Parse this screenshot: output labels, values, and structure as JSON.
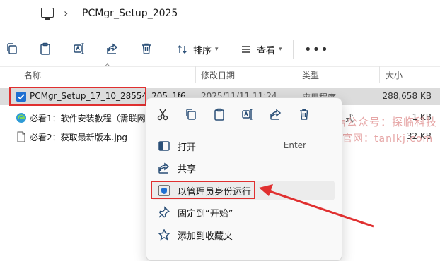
{
  "address": {
    "crumb": "PCMgr_Setup_2025"
  },
  "toolbar": {
    "sort_label": "排序",
    "view_label": "查看"
  },
  "columns": {
    "name": "名称",
    "date": "修改日期",
    "type": "类型",
    "size": "大小"
  },
  "files": [
    {
      "name": "PCMgr_Setup_17_10_28554_205_1f6...",
      "date": "2025/11/11 11:24",
      "type": "应用程序",
      "size": "288,658 KB"
    },
    {
      "name": "必看1：软件安装教程（需联网",
      "type": "式",
      "size": "1 KB"
    },
    {
      "name": "必看2：获取最新版本.jpg",
      "size": "32 KB"
    }
  ],
  "menu": {
    "open": "打开",
    "open_key": "Enter",
    "share": "共享",
    "run_as_admin": "以管理员身份运行",
    "pin_start": "固定到“开始”",
    "add_favorites": "添加到收藏夹"
  },
  "watermark": {
    "line1": "微信公众号：探临科技",
    "line2": "官网：tanlkj.com"
  },
  "colors": {
    "highlight": "#e03030",
    "selected_row": "#dcdcdc",
    "icon_blue": "#2a4f77"
  }
}
